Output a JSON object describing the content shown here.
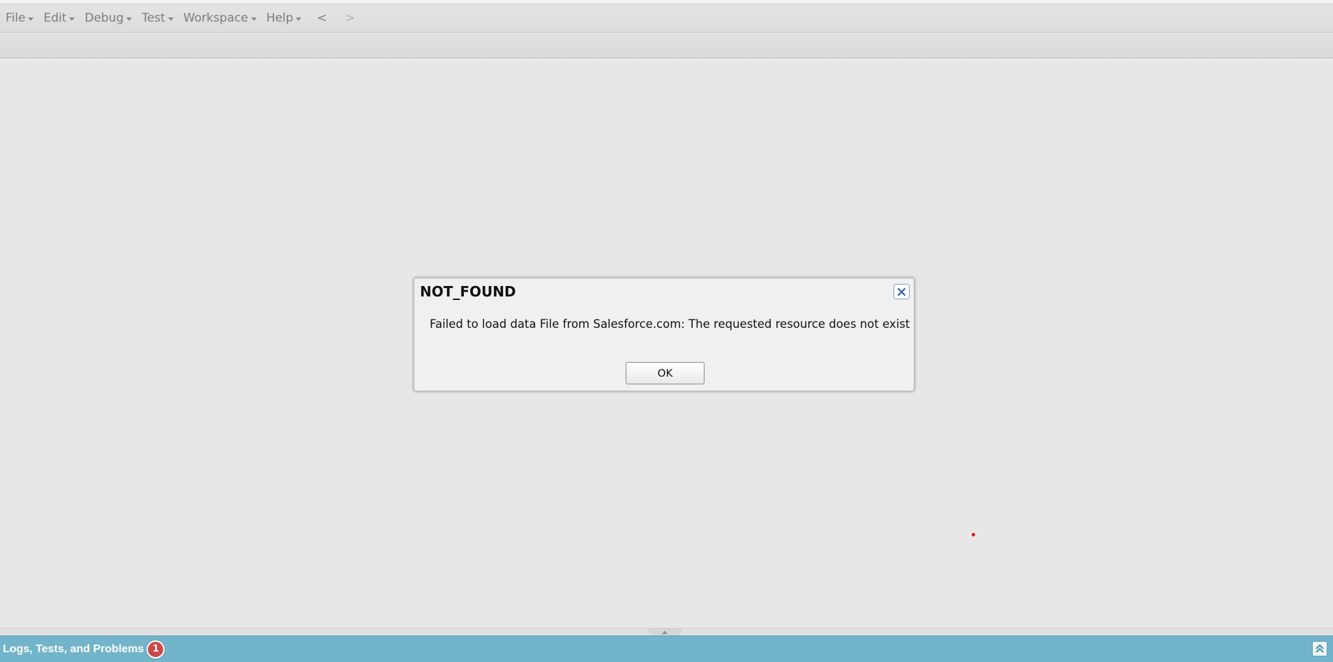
{
  "menubar": {
    "items": [
      {
        "label": "File"
      },
      {
        "label": "Edit"
      },
      {
        "label": "Debug"
      },
      {
        "label": "Test"
      },
      {
        "label": "Workspace"
      },
      {
        "label": "Help"
      }
    ],
    "back_label": "<",
    "forward_label": ">"
  },
  "dialog": {
    "title": "NOT_FOUND",
    "message": "Failed to load data File from Salesforce.com: The requested resource does not exist",
    "ok_label": "OK",
    "close_icon": "close-icon"
  },
  "bottom_panel": {
    "title": "Logs, Tests, and Problems",
    "badge_count": "1",
    "collapse_icon": "double-chevron-up-icon"
  },
  "colors": {
    "panel_accent": "#72b4c9",
    "badge": "#c94a4a",
    "background": "#e7e7e7"
  }
}
